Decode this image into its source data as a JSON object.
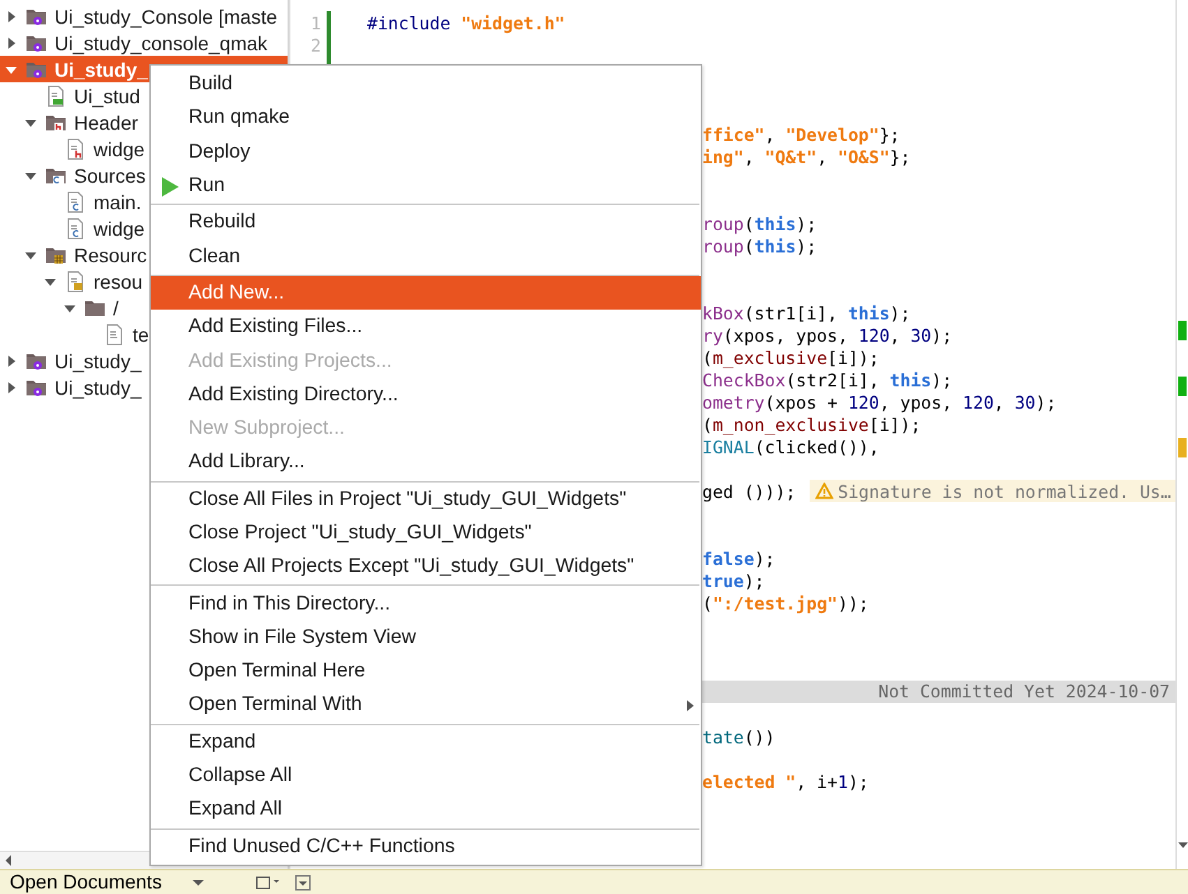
{
  "project_tree": {
    "items": [
      {
        "label": "Ui_study_Console [maste",
        "kind": "project",
        "expanded": false,
        "selected": false
      },
      {
        "label": "Ui_study_console_qmak",
        "kind": "project",
        "expanded": false,
        "selected": false
      },
      {
        "label": "Ui_study_",
        "kind": "project",
        "expanded": true,
        "selected": true,
        "children": [
          {
            "label": "Ui_stud",
            "kind": "profile",
            "selected": false
          },
          {
            "label": "Header",
            "kind": "headers",
            "expanded": true,
            "selected": false,
            "children": [
              {
                "label": "widge",
                "kind": "header-file",
                "selected": false
              }
            ]
          },
          {
            "label": "Sources",
            "kind": "sources",
            "expanded": true,
            "selected": false,
            "children": [
              {
                "label": "main.",
                "kind": "source-file",
                "selected": false
              },
              {
                "label": "widge",
                "kind": "source-file",
                "selected": false
              }
            ]
          },
          {
            "label": "Resourc",
            "kind": "resources",
            "expanded": true,
            "selected": false,
            "children": [
              {
                "label": "resou",
                "kind": "qrc",
                "expanded": true,
                "selected": false,
                "children": [
                  {
                    "label": "/",
                    "kind": "folder",
                    "expanded": true,
                    "selected": false,
                    "children": [
                      {
                        "label": "te",
                        "kind": "file",
                        "selected": false
                      }
                    ]
                  }
                ]
              }
            ]
          }
        ]
      },
      {
        "label": "Ui_study_",
        "kind": "project",
        "expanded": false,
        "selected": false
      },
      {
        "label": "Ui_study_",
        "kind": "project",
        "expanded": false,
        "selected": false
      }
    ]
  },
  "bottom_bar": {
    "open_documents": "Open Documents"
  },
  "editor": {
    "lines": [
      {
        "kind": "full",
        "number": "1",
        "tokens": [
          {
            "t": "#include ",
            "kind": "pre"
          },
          {
            "t": "\"widget.h\"",
            "kind": "str"
          }
        ]
      },
      {
        "kind": "blank",
        "number": "2"
      },
      {
        "kind": "blank"
      },
      {
        "kind": "blank"
      },
      {
        "kind": "blank"
      },
      {
        "kind": "partial",
        "tokens": [
          {
            "t": "ffice\"",
            "kind": "str"
          },
          {
            "t": ", ",
            "kind": "plain"
          },
          {
            "t": "\"Develop\"",
            "kind": "str"
          },
          {
            "t": "};",
            "kind": "plain"
          }
        ]
      },
      {
        "kind": "partial",
        "tokens": [
          {
            "t": "ing\"",
            "kind": "str"
          },
          {
            "t": ", ",
            "kind": "plain"
          },
          {
            "t": "\"Q&t\"",
            "kind": "str"
          },
          {
            "t": ", ",
            "kind": "plain"
          },
          {
            "t": "\"O&S\"",
            "kind": "str"
          },
          {
            "t": "};",
            "kind": "plain"
          }
        ]
      },
      {
        "kind": "blank"
      },
      {
        "kind": "blank"
      },
      {
        "kind": "partial",
        "tokens": [
          {
            "t": "roup",
            "kind": "func"
          },
          {
            "t": "(",
            "kind": "plain"
          },
          {
            "t": "this",
            "kind": "kw"
          },
          {
            "t": ");",
            "kind": "plain"
          }
        ]
      },
      {
        "kind": "partial",
        "tokens": [
          {
            "t": "roup",
            "kind": "func"
          },
          {
            "t": "(",
            "kind": "plain"
          },
          {
            "t": "this",
            "kind": "kw"
          },
          {
            "t": ");",
            "kind": "plain"
          }
        ]
      },
      {
        "kind": "blank"
      },
      {
        "kind": "blank"
      },
      {
        "kind": "partial",
        "tokens": [
          {
            "t": "kBox",
            "kind": "func"
          },
          {
            "t": "(str1[i], ",
            "kind": "plain"
          },
          {
            "t": "this",
            "kind": "kw"
          },
          {
            "t": ");",
            "kind": "plain"
          }
        ]
      },
      {
        "kind": "partial",
        "tokens": [
          {
            "t": "ry",
            "kind": "func"
          },
          {
            "t": "(xpos, ypos, ",
            "kind": "plain"
          },
          {
            "t": "120",
            "kind": "num"
          },
          {
            "t": ", ",
            "kind": "plain"
          },
          {
            "t": "30",
            "kind": "num"
          },
          {
            "t": ");",
            "kind": "plain"
          }
        ]
      },
      {
        "kind": "partial",
        "tokens": [
          {
            "t": "(",
            "kind": "plain"
          },
          {
            "t": "m_exclusive",
            "kind": "var"
          },
          {
            "t": "[i]);",
            "kind": "plain"
          }
        ]
      },
      {
        "kind": "partial",
        "tokens": [
          {
            "t": "CheckBox",
            "kind": "func"
          },
          {
            "t": "(str2[i], ",
            "kind": "plain"
          },
          {
            "t": "this",
            "kind": "kw"
          },
          {
            "t": ");",
            "kind": "plain"
          }
        ]
      },
      {
        "kind": "partial",
        "tokens": [
          {
            "t": "ometry",
            "kind": "func"
          },
          {
            "t": "(xpos + ",
            "kind": "plain"
          },
          {
            "t": "120",
            "kind": "num"
          },
          {
            "t": ", ypos, ",
            "kind": "plain"
          },
          {
            "t": "120",
            "kind": "num"
          },
          {
            "t": ", ",
            "kind": "plain"
          },
          {
            "t": "30",
            "kind": "num"
          },
          {
            "t": ");",
            "kind": "plain"
          }
        ]
      },
      {
        "kind": "partial",
        "tokens": [
          {
            "t": "(",
            "kind": "plain"
          },
          {
            "t": "m_non_exclusive",
            "kind": "var"
          },
          {
            "t": "[i]);",
            "kind": "plain"
          }
        ]
      },
      {
        "kind": "partial",
        "tokens": [
          {
            "t": "IGNAL",
            "kind": "macro"
          },
          {
            "t": "(clicked()),",
            "kind": "plain"
          }
        ]
      },
      {
        "kind": "blank"
      },
      {
        "kind": "partial",
        "tokens": [
          {
            "t": "ged ()));",
            "kind": "plain"
          }
        ],
        "warning": "Signature is not normalized. Us…"
      },
      {
        "kind": "blank"
      },
      {
        "kind": "blank"
      },
      {
        "kind": "partial",
        "tokens": [
          {
            "t": "false",
            "kind": "kw"
          },
          {
            "t": ");",
            "kind": "plain"
          }
        ]
      },
      {
        "kind": "partial",
        "tokens": [
          {
            "t": "true",
            "kind": "kw"
          },
          {
            "t": ");",
            "kind": "plain"
          }
        ]
      },
      {
        "kind": "partial",
        "tokens": [
          {
            "t": "(",
            "kind": "plain"
          },
          {
            "t": "\":/test.jpg\"",
            "kind": "str"
          },
          {
            "t": "));",
            "kind": "plain"
          }
        ]
      },
      {
        "kind": "blank"
      },
      {
        "kind": "blank"
      },
      {
        "kind": "blank"
      },
      {
        "kind": "blame",
        "text": "Not Committed Yet 2024-10-07"
      },
      {
        "kind": "blank"
      },
      {
        "kind": "partial",
        "tokens": [
          {
            "t": "tate",
            "kind": "func2"
          },
          {
            "t": "())",
            "kind": "plain"
          }
        ]
      },
      {
        "kind": "blank"
      },
      {
        "kind": "partial",
        "tokens": [
          {
            "t": "elected \"",
            "kind": "str"
          },
          {
            "t": ", i+",
            "kind": "plain"
          },
          {
            "t": "1",
            "kind": "num"
          },
          {
            "t": ");",
            "kind": "plain"
          }
        ]
      }
    ]
  },
  "context_menu": {
    "items": [
      {
        "kind": "action",
        "label": "Build",
        "disabled": false,
        "selected": false,
        "submenu": false
      },
      {
        "kind": "action",
        "label": "Run qmake",
        "disabled": false,
        "selected": false,
        "submenu": false
      },
      {
        "kind": "action",
        "label": "Deploy",
        "disabled": false,
        "selected": false,
        "submenu": false
      },
      {
        "kind": "action",
        "label": "Run",
        "disabled": false,
        "selected": false,
        "submenu": false
      },
      {
        "kind": "separator"
      },
      {
        "kind": "action",
        "label": "Rebuild",
        "disabled": false,
        "selected": false,
        "submenu": false
      },
      {
        "kind": "action",
        "label": "Clean",
        "disabled": false,
        "selected": false,
        "submenu": false
      },
      {
        "kind": "separator"
      },
      {
        "kind": "action",
        "label": "Add New...",
        "disabled": false,
        "selected": true,
        "submenu": false
      },
      {
        "kind": "action",
        "label": "Add Existing Files...",
        "disabled": false,
        "selected": false,
        "submenu": false
      },
      {
        "kind": "action",
        "label": "Add Existing Projects...",
        "disabled": true,
        "selected": false,
        "submenu": false
      },
      {
        "kind": "action",
        "label": "Add Existing Directory...",
        "disabled": false,
        "selected": false,
        "submenu": false
      },
      {
        "kind": "action",
        "label": "New Subproject...",
        "disabled": true,
        "selected": false,
        "submenu": false
      },
      {
        "kind": "action",
        "label": "Add Library...",
        "disabled": false,
        "selected": false,
        "submenu": false
      },
      {
        "kind": "separator"
      },
      {
        "kind": "action",
        "label": "Close All Files in Project \"Ui_study_GUI_Widgets\"",
        "disabled": false,
        "selected": false,
        "submenu": false
      },
      {
        "kind": "action",
        "label": "Close Project \"Ui_study_GUI_Widgets\"",
        "disabled": false,
        "selected": false,
        "submenu": false
      },
      {
        "kind": "action",
        "label": "Close All Projects Except \"Ui_study_GUI_Widgets\"",
        "disabled": false,
        "selected": false,
        "submenu": false
      },
      {
        "kind": "separator"
      },
      {
        "kind": "action",
        "label": "Find in This Directory...",
        "disabled": false,
        "selected": false,
        "submenu": false
      },
      {
        "kind": "action",
        "label": "Show in File System View",
        "disabled": false,
        "selected": false,
        "submenu": false
      },
      {
        "kind": "action",
        "label": "Open Terminal Here",
        "disabled": false,
        "selected": false,
        "submenu": false
      },
      {
        "kind": "action",
        "label": "Open Terminal With",
        "disabled": false,
        "selected": false,
        "submenu": true
      },
      {
        "kind": "separator"
      },
      {
        "kind": "action",
        "label": "Expand",
        "disabled": false,
        "selected": false,
        "submenu": false
      },
      {
        "kind": "action",
        "label": "Collapse All",
        "disabled": false,
        "selected": false,
        "submenu": false
      },
      {
        "kind": "action",
        "label": "Expand All",
        "disabled": false,
        "selected": false,
        "submenu": false
      },
      {
        "kind": "separator"
      },
      {
        "kind": "action",
        "label": "Find Unused C/C++ Functions",
        "disabled": false,
        "selected": false,
        "submenu": false
      }
    ]
  }
}
